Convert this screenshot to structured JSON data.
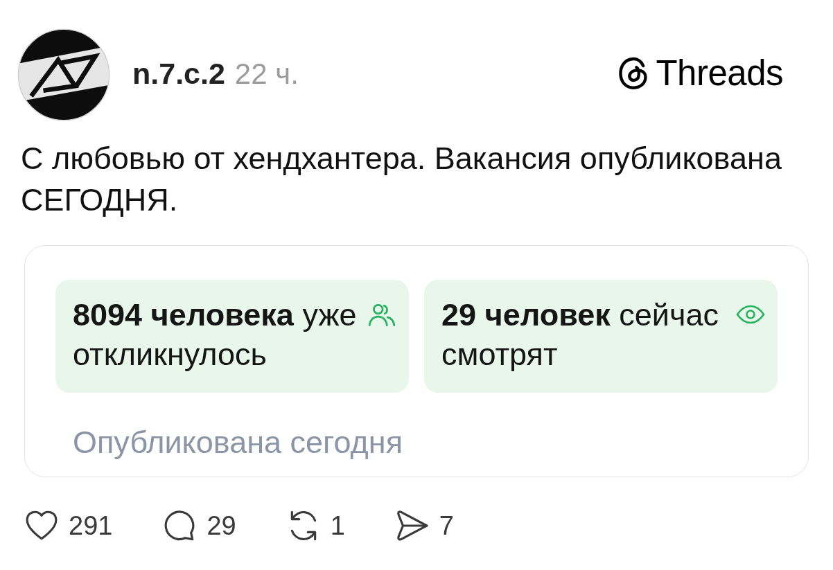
{
  "post": {
    "author": {
      "username": "n.7.c.2",
      "time": "22 ч."
    },
    "brand": {
      "name": "Threads"
    },
    "text": "С любовью от хендхантера. Вакансия опубликована СЕГОДНЯ.",
    "card": {
      "stats": [
        {
          "kind": "responses",
          "text": "**8094 человека** уже откликнулось"
        },
        {
          "kind": "viewers",
          "text": "**29 человек** сейчас смотрят"
        }
      ],
      "footer": "Опубликована сегодня"
    },
    "actions": [
      {
        "kind": "like",
        "count": "291"
      },
      {
        "kind": "comment",
        "count": "29"
      },
      {
        "kind": "repost",
        "count": "1"
      },
      {
        "kind": "share",
        "count": "7"
      }
    ]
  }
}
